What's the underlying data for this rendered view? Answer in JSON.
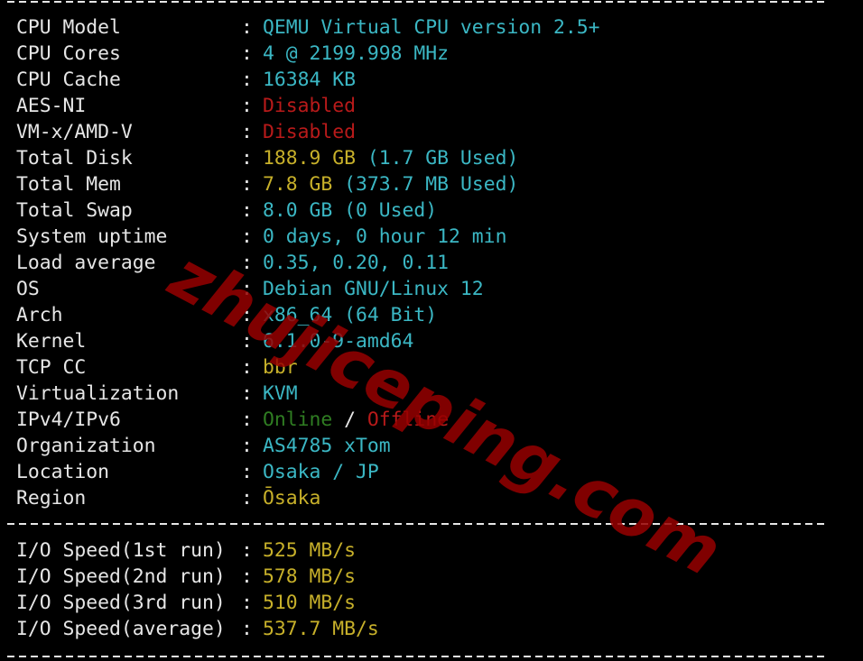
{
  "system_info": [
    {
      "label": "CPU Model",
      "parts": [
        {
          "text": "QEMU Virtual CPU version 2.5+",
          "color": "cyan"
        }
      ]
    },
    {
      "label": "CPU Cores",
      "parts": [
        {
          "text": "4 @ 2199.998 MHz",
          "color": "cyan"
        }
      ]
    },
    {
      "label": "CPU Cache",
      "parts": [
        {
          "text": "16384 KB",
          "color": "cyan"
        }
      ]
    },
    {
      "label": "AES-NI",
      "parts": [
        {
          "text": "Disabled",
          "color": "red"
        }
      ]
    },
    {
      "label": "VM-x/AMD-V",
      "parts": [
        {
          "text": "Disabled",
          "color": "red"
        }
      ]
    },
    {
      "label": "Total Disk",
      "parts": [
        {
          "text": "188.9 GB ",
          "color": "yellow"
        },
        {
          "text": "(1.7 GB Used)",
          "color": "cyan"
        }
      ]
    },
    {
      "label": "Total Mem",
      "parts": [
        {
          "text": "7.8 GB ",
          "color": "yellow"
        },
        {
          "text": "(373.7 MB Used)",
          "color": "cyan"
        }
      ]
    },
    {
      "label": "Total Swap",
      "parts": [
        {
          "text": "8.0 GB (0 Used)",
          "color": "cyan"
        }
      ]
    },
    {
      "label": "System uptime",
      "parts": [
        {
          "text": "0 days, 0 hour 12 min",
          "color": "cyan"
        }
      ]
    },
    {
      "label": "Load average",
      "parts": [
        {
          "text": "0.35, 0.20, 0.11",
          "color": "cyan"
        }
      ]
    },
    {
      "label": "OS",
      "parts": [
        {
          "text": "Debian GNU/Linux 12",
          "color": "cyan"
        }
      ]
    },
    {
      "label": "Arch",
      "parts": [
        {
          "text": "x86_64 (64 Bit)",
          "color": "cyan"
        }
      ]
    },
    {
      "label": "Kernel",
      "parts": [
        {
          "text": "6.1.0-9-amd64",
          "color": "cyan"
        }
      ]
    },
    {
      "label": "TCP CC",
      "parts": [
        {
          "text": "bbr",
          "color": "yellow"
        }
      ]
    },
    {
      "label": "Virtualization",
      "parts": [
        {
          "text": "KVM",
          "color": "cyan"
        }
      ]
    },
    {
      "label": "IPv4/IPv6",
      "parts": [
        {
          "text": "Online",
          "color": "green"
        },
        {
          "text": " / ",
          "color": "white"
        },
        {
          "text": "Offline",
          "color": "red"
        }
      ]
    },
    {
      "label": "Organization",
      "parts": [
        {
          "text": "AS4785 xTom",
          "color": "cyan"
        }
      ]
    },
    {
      "label": "Location",
      "parts": [
        {
          "text": "Osaka / JP",
          "color": "cyan"
        }
      ]
    },
    {
      "label": "Region",
      "parts": [
        {
          "text": "Ōsaka",
          "color": "yellow"
        }
      ]
    }
  ],
  "io_speed": [
    {
      "label": "I/O Speed(1st run)",
      "parts": [
        {
          "text": "525 MB/s",
          "color": "yellow"
        }
      ]
    },
    {
      "label": "I/O Speed(2nd run)",
      "parts": [
        {
          "text": "578 MB/s",
          "color": "yellow"
        }
      ]
    },
    {
      "label": "I/O Speed(3rd run)",
      "parts": [
        {
          "text": "510 MB/s",
          "color": "yellow"
        }
      ]
    },
    {
      "label": "I/O Speed(average)",
      "parts": [
        {
          "text": "537.7 MB/s",
          "color": "yellow"
        }
      ]
    }
  ],
  "separator": ":",
  "watermark": "zhujiceping.com",
  "colors": {
    "cyan": "#3bb7c4",
    "yellow": "#c7b02a",
    "red": "#b81a1a",
    "green": "#2f7d22",
    "white": "#e6e6e6"
  }
}
